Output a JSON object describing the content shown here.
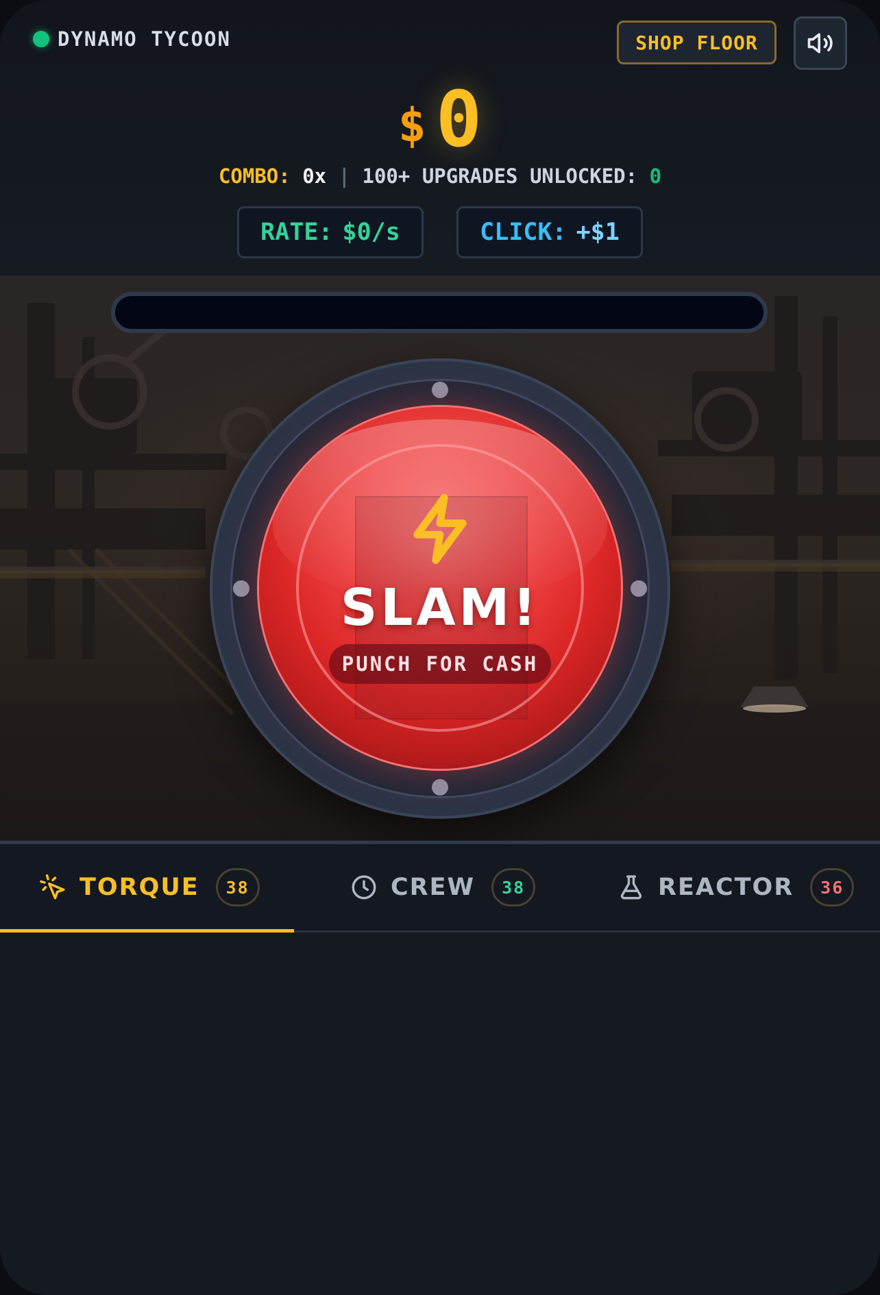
{
  "header": {
    "brand": "DYNAMO TYCOON",
    "status_color": "#10c27d",
    "shop_label": "SHOP FLOOR",
    "sound_icon": "speaker-volume-icon"
  },
  "wallet": {
    "currency_symbol": "$",
    "amount": "0"
  },
  "stats": {
    "combo_label": "COMBO:",
    "combo_value": "0x",
    "separator": "|",
    "upgrades_label": "100+ UPGRADES UNLOCKED:",
    "upgrades_value": "0"
  },
  "rate": {
    "label": "RATE:",
    "value": "$0/s"
  },
  "click": {
    "label": "CLICK:",
    "value": "+$1"
  },
  "progress": {
    "fraction": 0
  },
  "slam_button": {
    "icon": "lightning-bolt-icon",
    "title": "SLAM!",
    "subtitle": "PUNCH FOR CASH"
  },
  "tabs": [
    {
      "label": "TORQUE",
      "count": "38",
      "icon": "cursor-click-icon",
      "active": true,
      "badge_color": "#fbbf24"
    },
    {
      "label": "CREW",
      "count": "38",
      "icon": "clock-icon",
      "active": false,
      "badge_color": "#34d399"
    },
    {
      "label": "REACTOR",
      "count": "36",
      "icon": "flask-icon",
      "active": false,
      "badge_color": "#f87171"
    }
  ],
  "colors": {
    "accent": "#fbbf24",
    "button_red": "#ef4444",
    "rate_green": "#34d399",
    "click_blue": "#38bdf8"
  }
}
